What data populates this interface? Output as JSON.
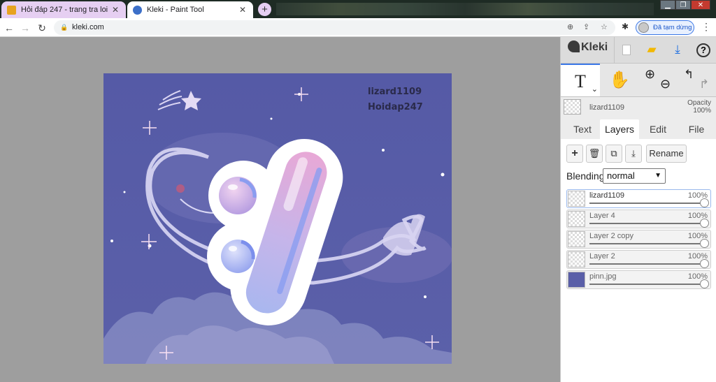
{
  "browser": {
    "tabs": [
      {
        "title": "Hỏi đáp 247 - trang tra loi",
        "favicon_color": "#e7a320"
      },
      {
        "title": "Kleki - Paint Tool",
        "favicon_color": "#3c6fc8"
      }
    ],
    "url": "kleki.com",
    "profile_label": "Đã tạm dừng",
    "new_tab_icon": "plus-icon"
  },
  "kleki": {
    "logo": "Kleki",
    "tools": {
      "text_tool_glyph": "T"
    },
    "current_layer": {
      "name": "lizard1109",
      "opacity_label": "Opacity",
      "opacity_value": "100%"
    },
    "panel_tabs": [
      "Text",
      "Layers",
      "Edit",
      "File"
    ],
    "active_tab": "Layers",
    "layer_buttons": {
      "rename": "Rename"
    },
    "blending": {
      "label": "Blending",
      "value": "normal"
    },
    "layers": [
      {
        "name": "lizard1109",
        "opacity": "100%",
        "selected": true
      },
      {
        "name": "Layer 4",
        "opacity": "100%",
        "selected": false
      },
      {
        "name": "Layer 2 copy",
        "opacity": "100%",
        "selected": false
      },
      {
        "name": "Layer 2",
        "opacity": "100%",
        "selected": false
      },
      {
        "name": "pinn.jpg",
        "opacity": "100%",
        "selected": false
      }
    ]
  },
  "artwork": {
    "watermark_line1": "lizard1109",
    "watermark_line2": "Hoidap247",
    "colors": {
      "background": "#5a5fa8",
      "accent_pink": "#e9a9d2",
      "accent_blue": "#8f9ff0"
    }
  }
}
